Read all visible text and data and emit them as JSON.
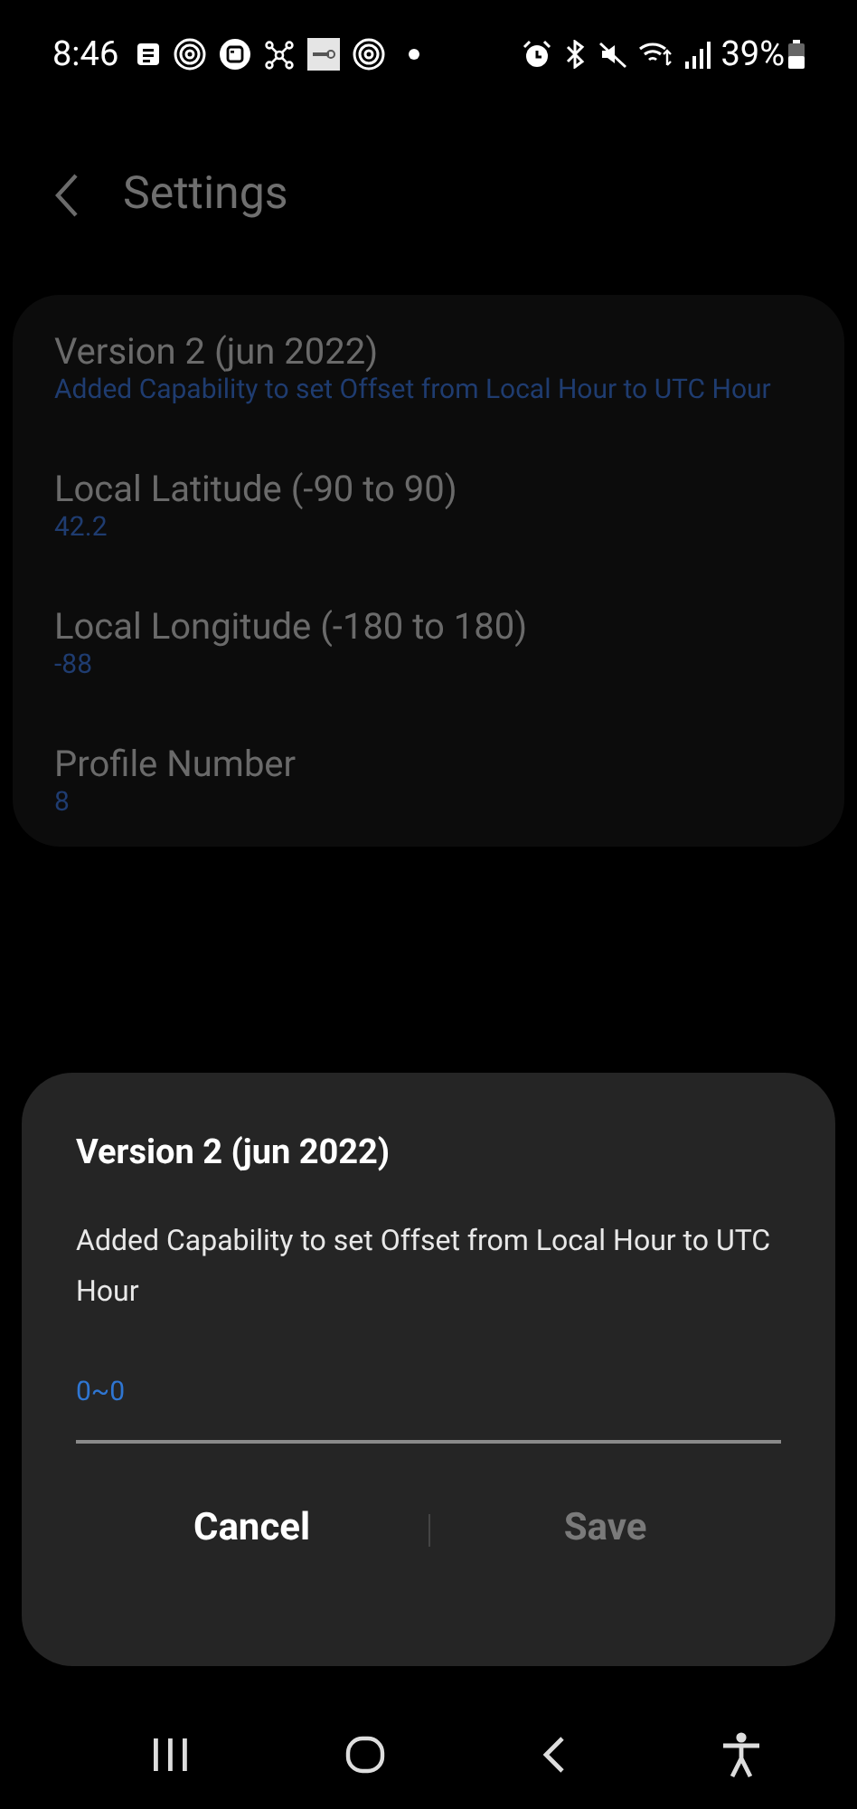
{
  "status_bar": {
    "time": "8:46",
    "battery": "39%"
  },
  "header": {
    "title": "Settings"
  },
  "settings": [
    {
      "title": "Version 2 (jun 2022)",
      "summary": "Added Capability to set Offset from Local Hour to UTC Hour"
    },
    {
      "title": "Local Latitude (-90 to 90)",
      "summary": "42.2"
    },
    {
      "title": "Local Longitude (-180 to 180)",
      "summary": "-88"
    },
    {
      "title": "Profile Number",
      "summary": "8"
    }
  ],
  "dialog": {
    "title": "Version 2 (jun 2022)",
    "message": "Added Capability to set Offset from Local Hour to UTC Hour",
    "input": {
      "placeholder": "0~0"
    },
    "buttons": [
      {
        "label": "Cancel",
        "disabled": false
      },
      {
        "label": "Save",
        "disabled": true
      }
    ]
  }
}
